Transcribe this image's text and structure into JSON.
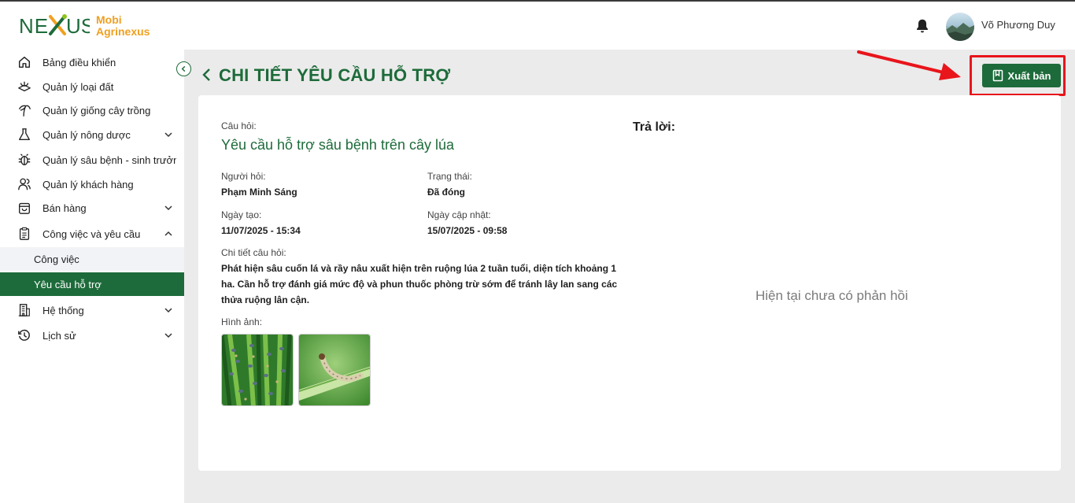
{
  "header": {
    "logo_text": "NEXUS",
    "brand_line1": "Mobi",
    "brand_line2": "Agrinexus",
    "user_name": "Võ Phương Duy",
    "icons": {
      "notification": "bell-icon",
      "avatar": "avatar"
    }
  },
  "sidebar": {
    "items": [
      {
        "label": "Bảng điều khiển",
        "icon": "home-icon",
        "has_children": false
      },
      {
        "label": "Quản lý loại đất",
        "icon": "soil-icon",
        "has_children": false
      },
      {
        "label": "Quản lý giống cây trồng",
        "icon": "plant-icon",
        "has_children": false
      },
      {
        "label": "Quản lý nông dược",
        "icon": "flask-icon",
        "has_children": true
      },
      {
        "label": "Quản lý sâu bệnh - sinh trưởng",
        "icon": "bug-icon",
        "has_children": false
      },
      {
        "label": "Quản lý khách hàng",
        "icon": "users-icon",
        "has_children": false
      },
      {
        "label": "Bán hàng",
        "icon": "shopping-bag-icon",
        "has_children": true
      },
      {
        "label": "Công việc và yêu cầu",
        "icon": "clipboard-icon",
        "has_children": true,
        "expanded": true
      },
      {
        "label": "Hệ thống",
        "icon": "building-icon",
        "has_children": true
      },
      {
        "label": "Lịch sử",
        "icon": "history-icon",
        "has_children": true
      }
    ],
    "sub_items": [
      {
        "label": "Công việc",
        "active": false
      },
      {
        "label": "Yêu cầu hỗ trợ",
        "active": true
      }
    ]
  },
  "page": {
    "title": "CHI TIẾT YÊU CẦU HỖ TRỢ",
    "publish_label": "Xuất bản"
  },
  "question": {
    "label": "Câu hỏi:",
    "title": "Yêu cầu hỗ trợ sâu bệnh trên cây lúa",
    "asker_label": "Người hỏi:",
    "asker": "Phạm Minh Sáng",
    "status_label": "Trạng thái:",
    "status": "Đã đóng",
    "created_label": "Ngày tạo:",
    "created": "11/07/2025 - 15:34",
    "updated_label": "Ngày cập nhật:",
    "updated": "15/07/2025 - 09:58",
    "detail_label": "Chi tiết câu hỏi:",
    "detail": "Phát hiện sâu cuốn lá và rầy nâu xuất hiện trên ruộng lúa 2 tuần tuổi, diện tích khoảng 1 ha. Cần hỗ trợ đánh giá mức độ và phun thuốc phòng trừ sớm để tránh lây lan sang các thửa ruộng lân cận.",
    "images_label": "Hình ảnh:",
    "images": [
      "brown-planthopper-photo",
      "leaf-roller-larva-photo"
    ]
  },
  "answer": {
    "label": "Trả lời:",
    "empty_text": "Hiện tại chưa có phản hồi"
  },
  "colors": {
    "brand_green": "#1d6b3a",
    "brand_orange": "#f0a020",
    "highlight_red": "#e8151b",
    "main_bg": "#ebebeb"
  }
}
